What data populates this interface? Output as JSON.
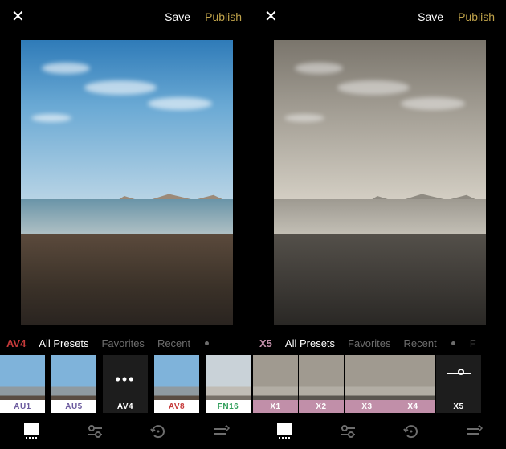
{
  "panes": [
    {
      "variantClass": "vc",
      "header": {
        "close": "✕",
        "save": "Save",
        "publish": "Publish"
      },
      "tabs": {
        "preset": {
          "text": "AV4",
          "color": "#c63a3a"
        },
        "items": [
          "All Presets",
          "Favorites",
          "Recent"
        ],
        "activeIndex": 0,
        "tail": ""
      },
      "thumbs": [
        {
          "kind": "img",
          "mini": "mini-c",
          "label": "AU1",
          "labelClass": "lbl-white-purple"
        },
        {
          "kind": "img",
          "mini": "mini-c",
          "label": "AU5",
          "labelClass": "lbl-white-purple"
        },
        {
          "kind": "current-ellipsis",
          "label": "AV4",
          "labelClass": "lbl-black"
        },
        {
          "kind": "img",
          "mini": "mini-c",
          "label": "AV8",
          "labelClass": "lbl-white-red"
        },
        {
          "kind": "img",
          "mini": "mini-f",
          "label": "FN16",
          "labelClass": "lbl-white-green"
        }
      ],
      "thumbGap": "8px"
    },
    {
      "variantClass": "vm",
      "header": {
        "close": "✕",
        "save": "Save",
        "publish": "Publish"
      },
      "tabs": {
        "preset": {
          "text": "X5",
          "color": "#c18fa9"
        },
        "items": [
          "All Presets",
          "Favorites",
          "Recent"
        ],
        "activeIndex": 0,
        "tail": "F"
      },
      "thumbs": [
        {
          "kind": "img",
          "mini": "mini-m",
          "label": "X1",
          "labelClass": "lbl-pink"
        },
        {
          "kind": "img",
          "mini": "mini-m",
          "label": "X2",
          "labelClass": "lbl-pink"
        },
        {
          "kind": "img",
          "mini": "mini-m",
          "label": "X3",
          "labelClass": "lbl-pink"
        },
        {
          "kind": "img",
          "mini": "mini-m",
          "label": "X4",
          "labelClass": "lbl-pink"
        },
        {
          "kind": "current-slider",
          "label": "X5",
          "labelClass": "lbl-black"
        }
      ],
      "thumbGap": "1px"
    }
  ],
  "bottomBar": {
    "activeIndex": 0,
    "icons": [
      "presets",
      "adjust",
      "history",
      "tools"
    ]
  }
}
